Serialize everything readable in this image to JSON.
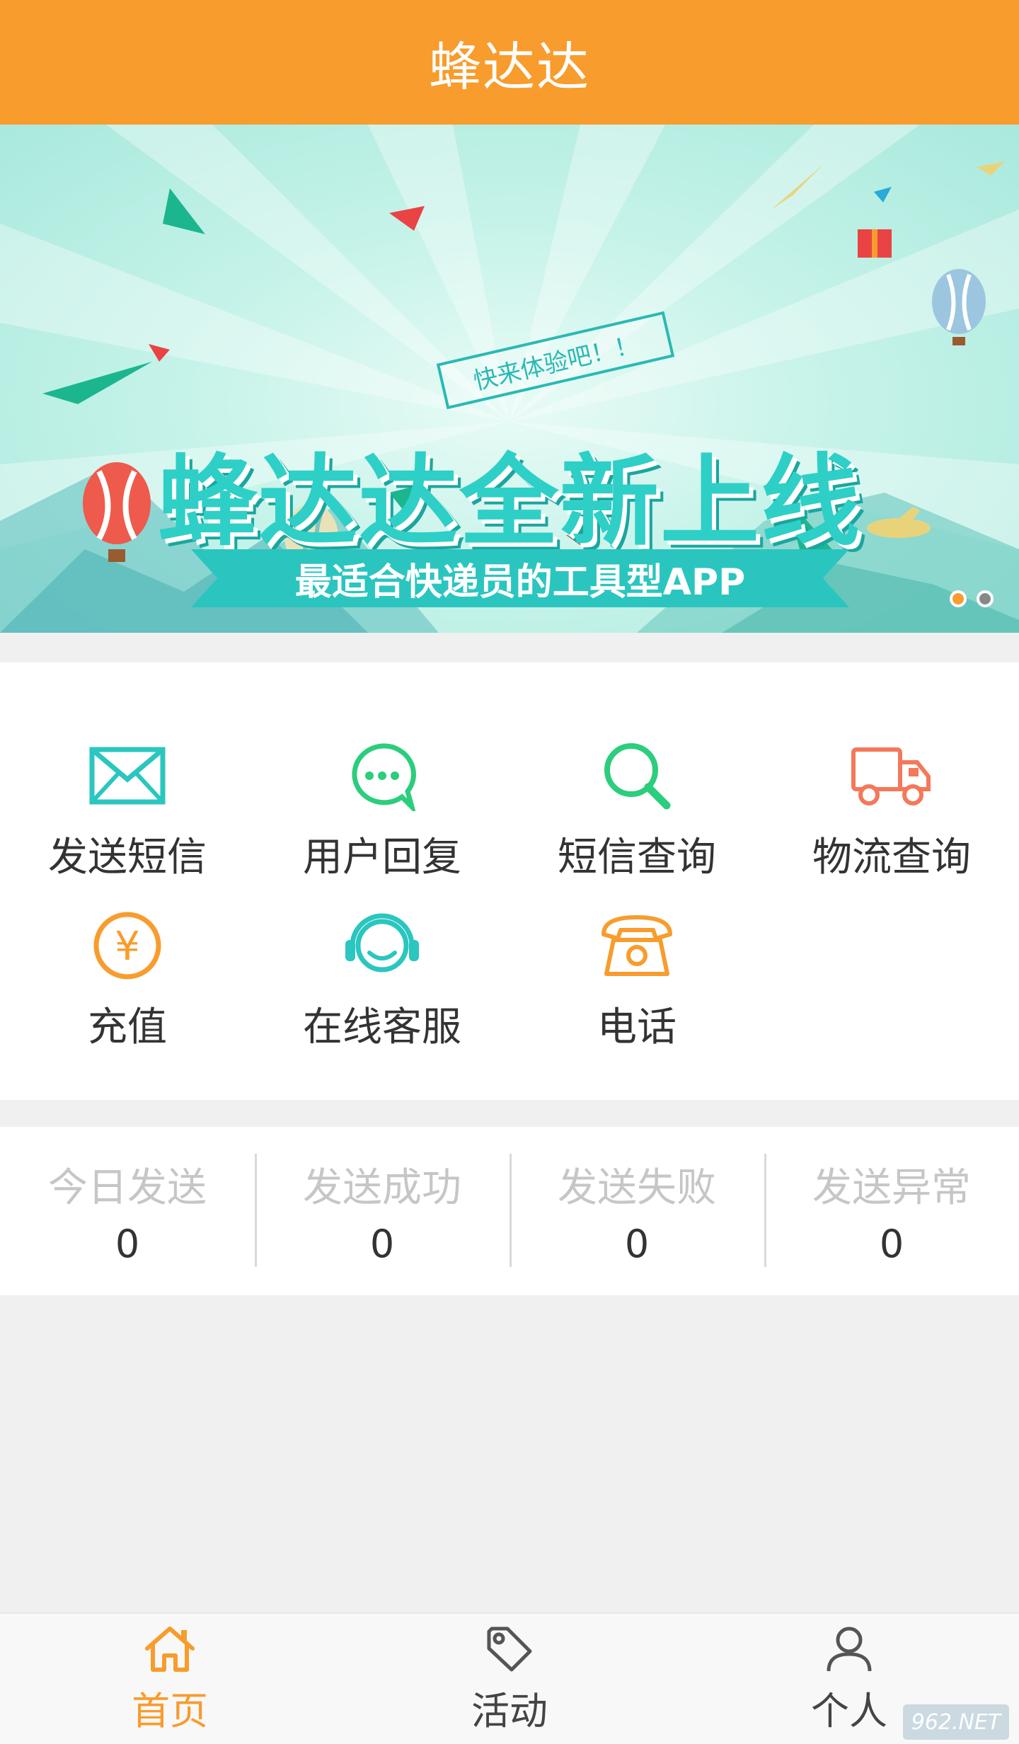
{
  "header": {
    "title": "蜂达达"
  },
  "banner": {
    "tag": "快来体验吧！！",
    "headline": "蜂达达全新上线",
    "subtitle": "最适合快递员的工具型APP",
    "pager": {
      "total": 2,
      "active": 1
    }
  },
  "menu": {
    "items": [
      {
        "label": "发送短信",
        "icon": "envelope-icon",
        "color": "#2ac6bf"
      },
      {
        "label": "用户回复",
        "icon": "chat-bubble-icon",
        "color": "#2ccd7c"
      },
      {
        "label": "短信查询",
        "icon": "search-icon",
        "color": "#2ccd7c"
      },
      {
        "label": "物流查询",
        "icon": "truck-icon",
        "color": "#f4785a"
      },
      {
        "label": "充值",
        "icon": "yen-coin-icon",
        "color": "#f89c2d"
      },
      {
        "label": "在线客服",
        "icon": "headset-icon",
        "color": "#2ac6bf"
      },
      {
        "label": "电话",
        "icon": "telephone-icon",
        "color": "#f89c2d"
      }
    ]
  },
  "stats": [
    {
      "label": "今日发送",
      "value": "0"
    },
    {
      "label": "发送成功",
      "value": "0"
    },
    {
      "label": "发送失败",
      "value": "0"
    },
    {
      "label": "发送异常",
      "value": "0"
    }
  ],
  "tabbar": {
    "items": [
      {
        "label": "首页",
        "icon": "home-icon",
        "active": true
      },
      {
        "label": "活动",
        "icon": "tag-icon",
        "active": false
      },
      {
        "label": "个人",
        "icon": "user-icon",
        "active": false
      }
    ]
  },
  "watermark": "962.NET",
  "colors": {
    "primary": "#f89c2d",
    "teal": "#2ac6bf",
    "green": "#2ccd7c",
    "coral": "#f4785a"
  }
}
